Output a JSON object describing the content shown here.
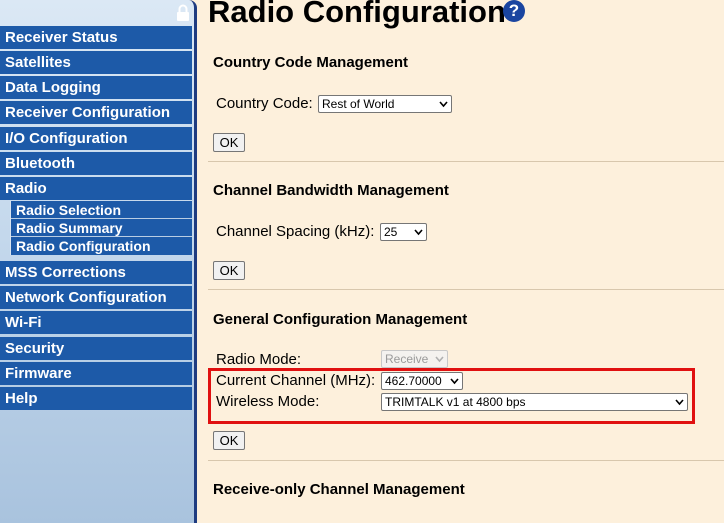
{
  "sidebar": {
    "items": [
      {
        "label": "Receiver Status"
      },
      {
        "label": "Satellites"
      },
      {
        "label": "Data Logging"
      },
      {
        "label": "Receiver Configuration"
      },
      {
        "label": "I/O Configuration"
      },
      {
        "label": "Bluetooth"
      },
      {
        "label": "Radio"
      },
      {
        "label": "MSS Corrections"
      },
      {
        "label": "Network Configuration"
      },
      {
        "label": "Wi-Fi"
      },
      {
        "label": "Security"
      },
      {
        "label": "Firmware"
      },
      {
        "label": "Help"
      }
    ],
    "radio_submenu": [
      {
        "label": "Radio Selection"
      },
      {
        "label": "Radio Summary"
      },
      {
        "label": "Radio Configuration"
      }
    ]
  },
  "main": {
    "title": "Radio Configuration",
    "help_icon": "question-mark-icon",
    "country": {
      "heading": "Country Code Management",
      "label": "Country Code:",
      "value": "Rest of World",
      "ok": "OK"
    },
    "bandwidth": {
      "heading": "Channel Bandwidth Management",
      "label": "Channel Spacing (kHz):",
      "value": "25",
      "ok": "OK"
    },
    "general": {
      "heading": "General Configuration Management",
      "radio_mode_label": "Radio Mode:",
      "radio_mode_value": "Receive",
      "channel_label": "Current Channel (MHz):",
      "channel_value": "462.70000",
      "wireless_label": "Wireless Mode:",
      "wireless_value": "TRIMTALK v1 at 4800 bps",
      "ok": "OK"
    },
    "receive_only": {
      "heading": "Receive-only Channel Management"
    }
  },
  "colors": {
    "page_bg": "#fdf0dc",
    "nav_bg": "#1d5aa8",
    "highlight": "#e01010"
  }
}
